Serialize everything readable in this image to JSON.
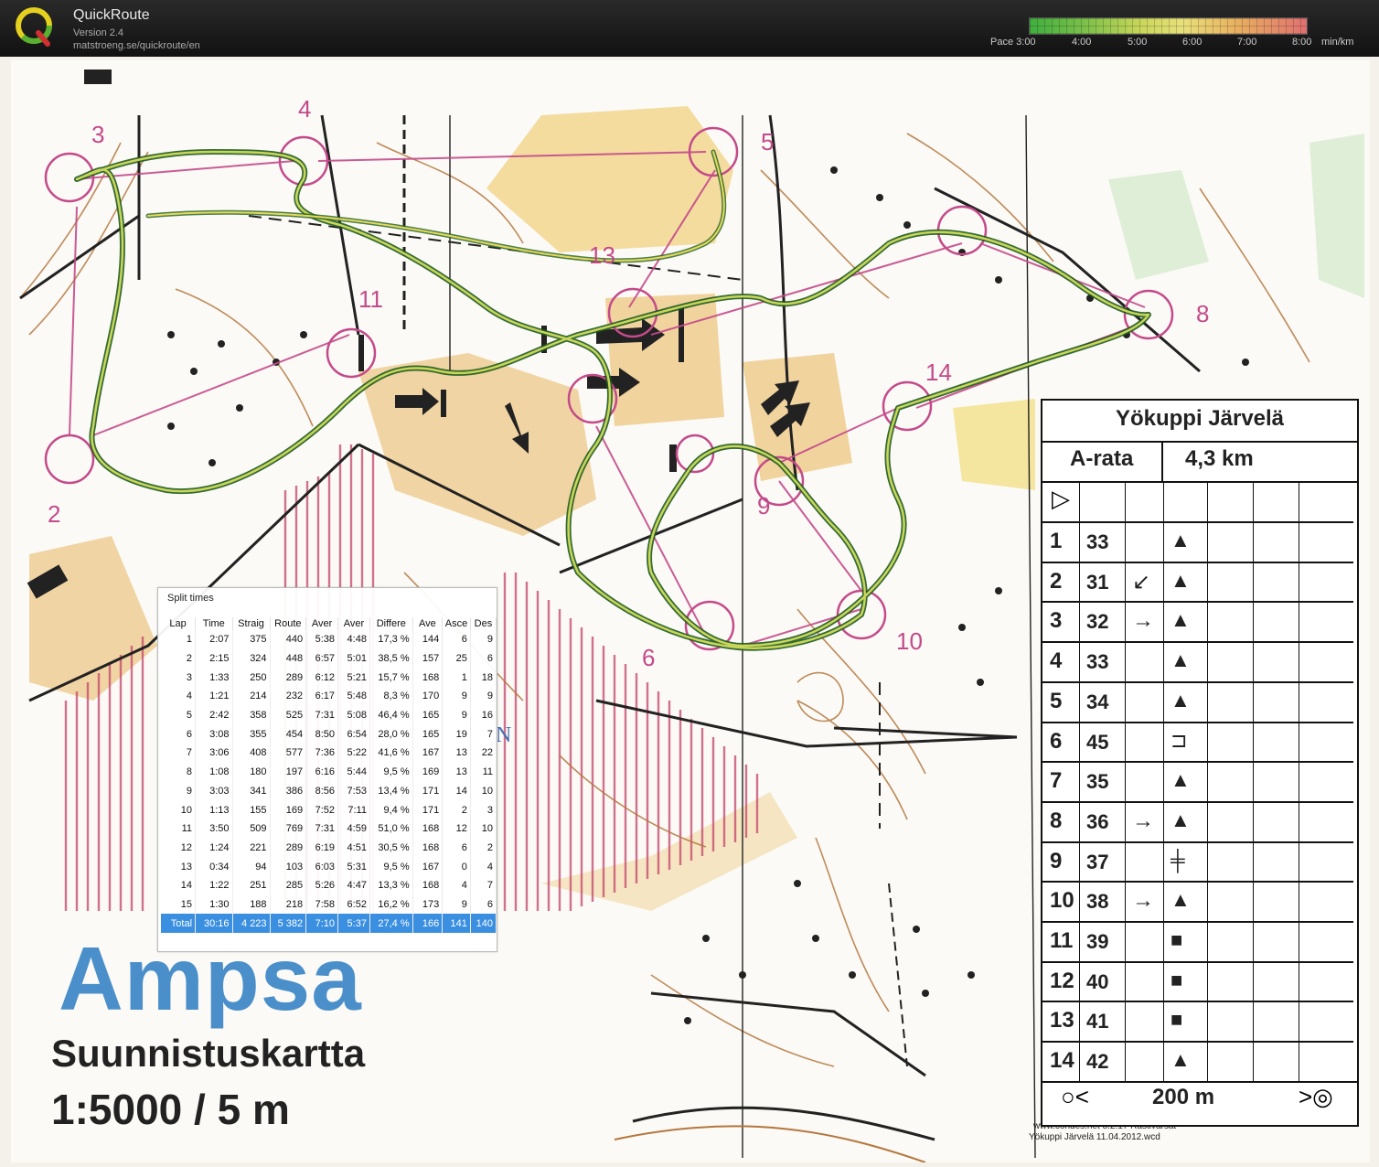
{
  "app": {
    "title": "QuickRoute",
    "version": "Version 2.4",
    "url": "matstroeng.se/quickroute/en"
  },
  "pace_scale": {
    "label_prefix": "Pace",
    "ticks": [
      "3:00",
      "4:00",
      "5:00",
      "6:00",
      "7:00",
      "8:00"
    ],
    "unit": "min/km",
    "colors": [
      "#3fae3f",
      "#c9d65a",
      "#e8e07a",
      "#e07070"
    ]
  },
  "map": {
    "title": "Ampsa",
    "subtitle": "Suunnistuskartta",
    "scale": "1:5000 / 5 m",
    "north_label": "N",
    "control_labels": [
      "2",
      "3",
      "4",
      "5",
      "6",
      "8",
      "9",
      "10",
      "11",
      "13",
      "14"
    ],
    "credits_line1": "www.condes.net 8.2.17 Rastivarsat",
    "credits_line2": "Yökuppi Järvelä 11.04.2012.wcd"
  },
  "control_card": {
    "title": "Yökuppi Järvelä",
    "course": "A-rata",
    "length": "4,3 km",
    "footer": "200 m",
    "rows": [
      {
        "num": "1",
        "code": "33",
        "dir": "",
        "sym": "▲"
      },
      {
        "num": "2",
        "code": "31",
        "dir": "↙",
        "sym": "▲"
      },
      {
        "num": "3",
        "code": "32",
        "dir": "→",
        "sym": "▲"
      },
      {
        "num": "4",
        "code": "33",
        "dir": "",
        "sym": "▲"
      },
      {
        "num": "5",
        "code": "34",
        "dir": "",
        "sym": "▲"
      },
      {
        "num": "6",
        "code": "45",
        "dir": "",
        "sym": "⊐"
      },
      {
        "num": "7",
        "code": "35",
        "dir": "",
        "sym": "▲"
      },
      {
        "num": "8",
        "code": "36",
        "dir": "→",
        "sym": "▲"
      },
      {
        "num": "9",
        "code": "37",
        "dir": "",
        "sym": "╪"
      },
      {
        "num": "10",
        "code": "38",
        "dir": "→",
        "sym": "▲"
      },
      {
        "num": "11",
        "code": "39",
        "dir": "",
        "sym": "■"
      },
      {
        "num": "12",
        "code": "40",
        "dir": "",
        "sym": "■"
      },
      {
        "num": "13",
        "code": "41",
        "dir": "",
        "sym": "■"
      },
      {
        "num": "14",
        "code": "42",
        "dir": "",
        "sym": "▲"
      }
    ]
  },
  "split_times": {
    "title": "Split times",
    "headers": [
      "Lap",
      "Time",
      "Straig",
      "Route",
      "Aver",
      "Aver",
      "Differe",
      "Ave",
      "Asce",
      "Des"
    ],
    "rows": [
      [
        "1",
        "2:07",
        "375",
        "440",
        "5:38",
        "4:48",
        "17,3 %",
        "144",
        "6",
        "9"
      ],
      [
        "2",
        "2:15",
        "324",
        "448",
        "6:57",
        "5:01",
        "38,5 %",
        "157",
        "25",
        "6"
      ],
      [
        "3",
        "1:33",
        "250",
        "289",
        "6:12",
        "5:21",
        "15,7 %",
        "168",
        "1",
        "18"
      ],
      [
        "4",
        "1:21",
        "214",
        "232",
        "6:17",
        "5:48",
        "8,3 %",
        "170",
        "9",
        "9"
      ],
      [
        "5",
        "2:42",
        "358",
        "525",
        "7:31",
        "5:08",
        "46,4 %",
        "165",
        "9",
        "16"
      ],
      [
        "6",
        "3:08",
        "355",
        "454",
        "8:50",
        "6:54",
        "28,0 %",
        "165",
        "19",
        "7"
      ],
      [
        "7",
        "3:06",
        "408",
        "577",
        "7:36",
        "5:22",
        "41,6 %",
        "167",
        "13",
        "22"
      ],
      [
        "8",
        "1:08",
        "180",
        "197",
        "6:16",
        "5:44",
        "9,5 %",
        "169",
        "13",
        "11"
      ],
      [
        "9",
        "3:03",
        "341",
        "386",
        "8:56",
        "7:53",
        "13,4 %",
        "171",
        "14",
        "10"
      ],
      [
        "10",
        "1:13",
        "155",
        "169",
        "7:52",
        "7:11",
        "9,4 %",
        "171",
        "2",
        "3"
      ],
      [
        "11",
        "3:50",
        "509",
        "769",
        "7:31",
        "4:59",
        "51,0 %",
        "168",
        "12",
        "10"
      ],
      [
        "12",
        "1:24",
        "221",
        "289",
        "6:19",
        "4:51",
        "30,5 %",
        "168",
        "6",
        "2"
      ],
      [
        "13",
        "0:34",
        "94",
        "103",
        "6:03",
        "5:31",
        "9,5 %",
        "167",
        "0",
        "4"
      ],
      [
        "14",
        "1:22",
        "251",
        "285",
        "5:26",
        "4:47",
        "13,3 %",
        "168",
        "4",
        "7"
      ],
      [
        "15",
        "1:30",
        "188",
        "218",
        "7:58",
        "6:52",
        "16,2 %",
        "173",
        "9",
        "6"
      ]
    ],
    "total": [
      "Total",
      "30:16",
      "4 223",
      "5 382",
      "7:10",
      "5:37",
      "27,4 %",
      "166",
      "141",
      "140"
    ]
  }
}
